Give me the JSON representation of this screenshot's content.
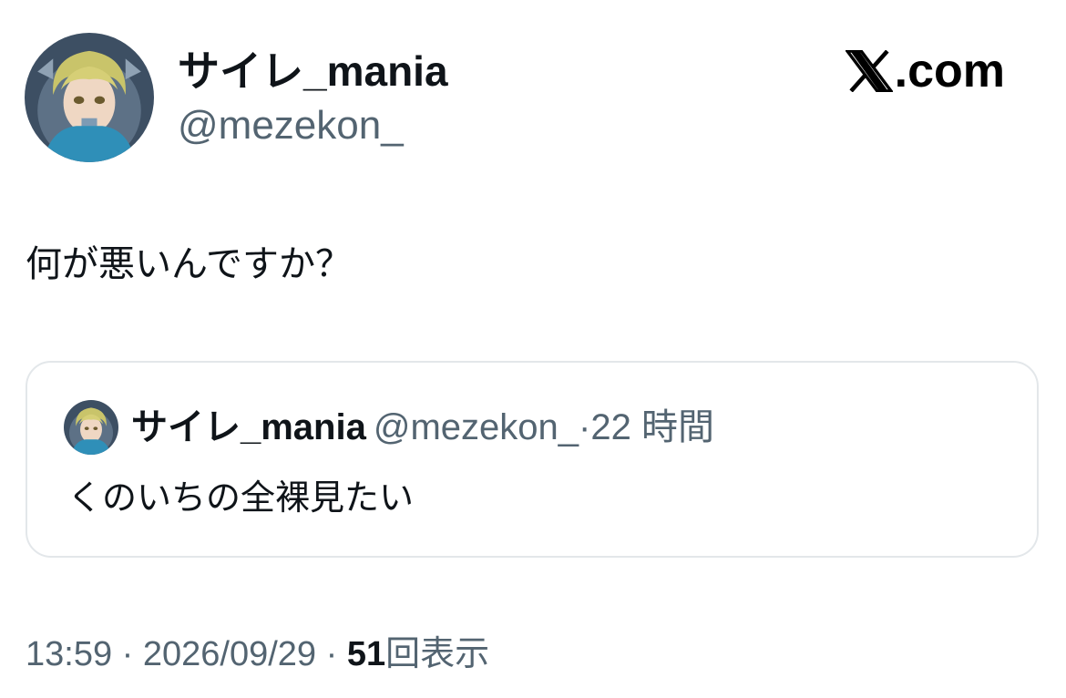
{
  "post": {
    "author": {
      "display_name": "サイレ_mania",
      "handle": "@mezekon_"
    },
    "brand": "X.com",
    "text": "何が悪いんですか？",
    "quoted": {
      "display_name": "サイレ_mania",
      "handle": "@mezekon_",
      "separator": "·",
      "time_ago": "22 時間",
      "text": "くのいちの全裸見たい"
    },
    "meta": {
      "time": "13:59",
      "sep1": " · ",
      "date": "2026/09/29",
      "sep2": " · ",
      "view_count": "51",
      "views_label": "回表示"
    }
  },
  "colors": {
    "text_primary": "#0f1419",
    "text_secondary": "#536471",
    "border": "#e3e7ea",
    "background": "#ffffff"
  },
  "icons": {
    "avatar": "anime-character-avatar",
    "brand_logo": "x-logo"
  }
}
